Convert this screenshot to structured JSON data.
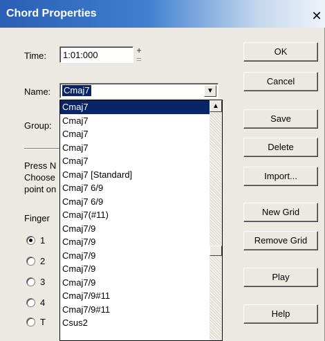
{
  "window": {
    "title": "Chord Properties",
    "close_glyph": "✕"
  },
  "time": {
    "label": "Time:",
    "value": "1:01:000",
    "spin_up": "+",
    "spin_down": "="
  },
  "name": {
    "label": "Name:",
    "value": "Cmaj7"
  },
  "group": {
    "label": "Group:"
  },
  "instructions": {
    "line1": "Press N",
    "line2": "Choose",
    "line3": "point on"
  },
  "finger": {
    "label": "Finger",
    "options": [
      {
        "label": "1",
        "checked": true
      },
      {
        "label": "2",
        "checked": false
      },
      {
        "label": "3",
        "checked": false
      },
      {
        "label": "4",
        "checked": false
      },
      {
        "label": "T",
        "checked": false
      }
    ]
  },
  "dropdown": {
    "selected_index": 0,
    "items": [
      "Cmaj7",
      "Cmaj7",
      "Cmaj7",
      "Cmaj7",
      "Cmaj7",
      "Cmaj7  [Standard]",
      "Cmaj7 6/9",
      "Cmaj7 6/9",
      "Cmaj7(#11)",
      "Cmaj7/9",
      "Cmaj7/9",
      "Cmaj7/9",
      "Cmaj7/9",
      "Cmaj7/9",
      "Cmaj7/9#11",
      "Cmaj7/9#11",
      "Csus2"
    ]
  },
  "buttons": {
    "ok": "OK",
    "cancel": "Cancel",
    "save": "Save",
    "delete": "Delete",
    "import": "Import...",
    "new_grid": "New Grid",
    "remove_grid": "Remove Grid",
    "play": "Play",
    "help": "Help"
  }
}
